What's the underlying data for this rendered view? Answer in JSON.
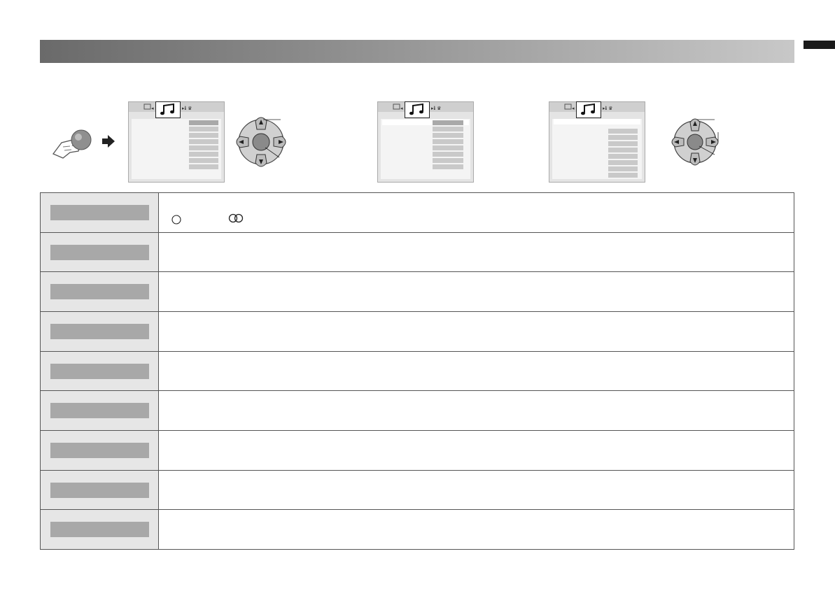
{
  "header": {
    "title": ""
  },
  "rows": [
    {
      "label": "",
      "desc": ""
    },
    {
      "label": "",
      "desc": ""
    },
    {
      "label": "",
      "desc": ""
    },
    {
      "label": "",
      "desc": ""
    },
    {
      "label": "",
      "desc": ""
    },
    {
      "label": "",
      "desc": ""
    },
    {
      "label": "",
      "desc": ""
    },
    {
      "label": "",
      "desc": ""
    },
    {
      "label": "",
      "desc": ""
    }
  ],
  "icons": {
    "hand": "pointing-hand-icon",
    "arrow": "right-arrow-icon",
    "menu_tab": "music-note-icon",
    "dpad": "dpad-icon",
    "mono": "single-circle-icon",
    "stereo": "double-circle-icon"
  }
}
